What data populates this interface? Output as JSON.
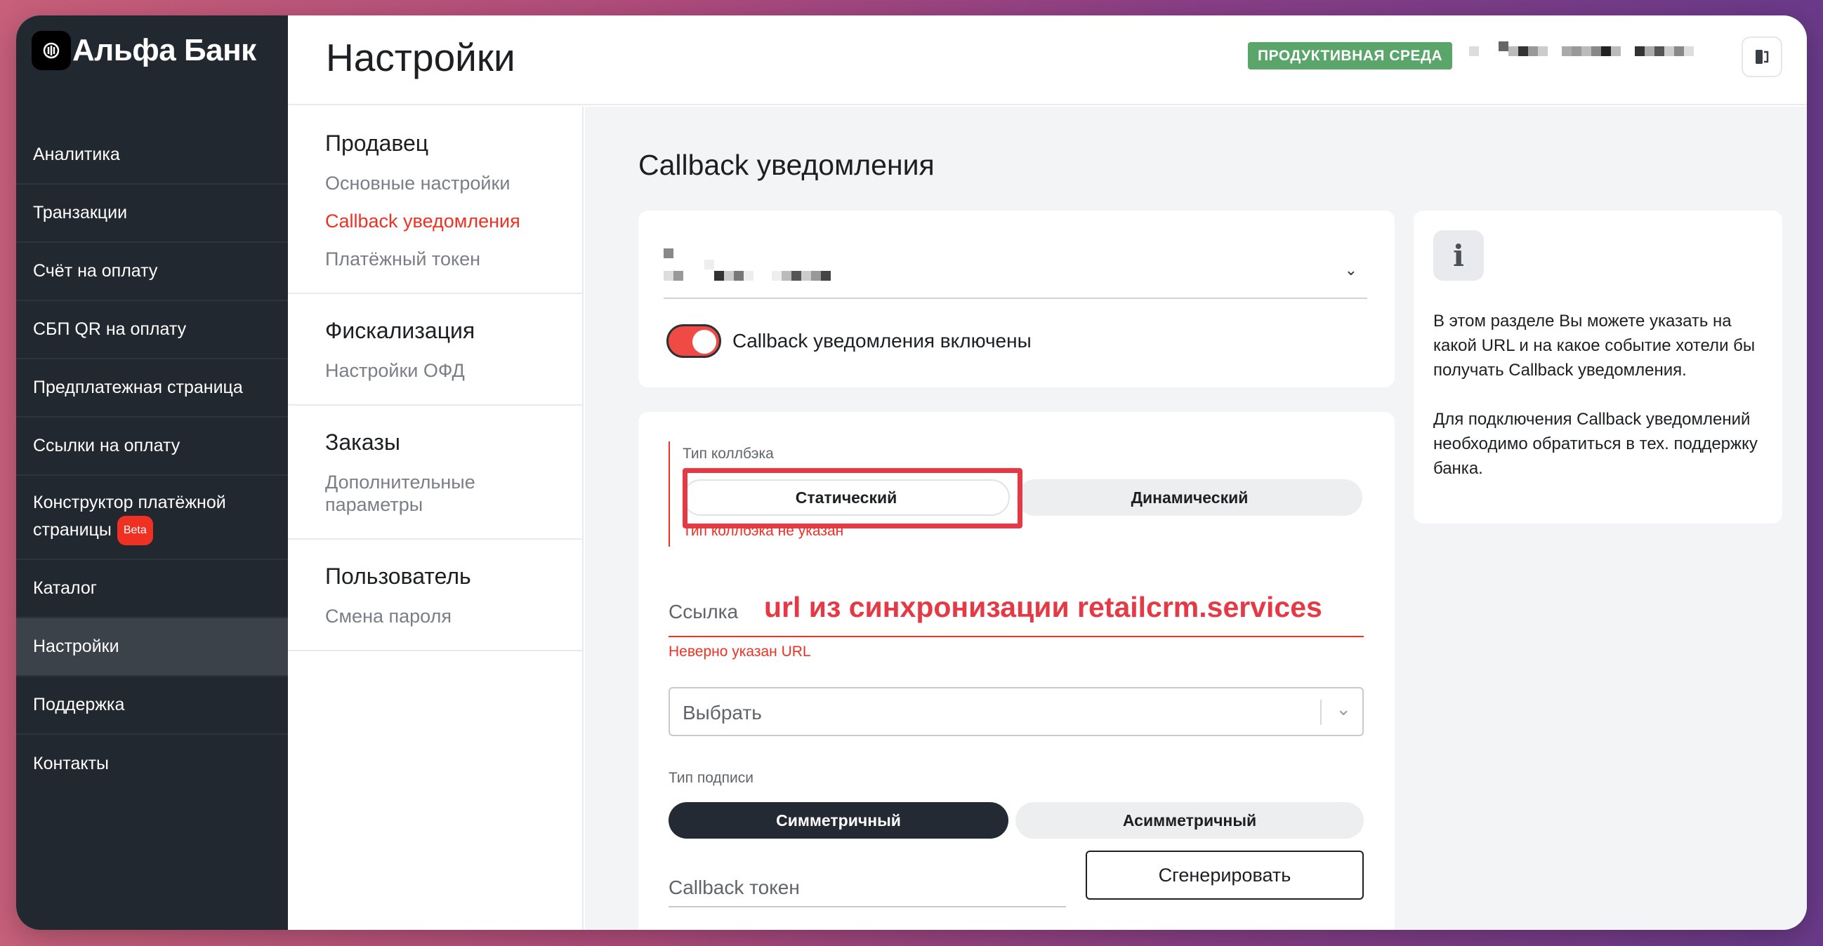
{
  "brand": {
    "name": "Альфа Банк"
  },
  "sidebar": {
    "items": [
      {
        "label": "Аналитика"
      },
      {
        "label": "Транзакции"
      },
      {
        "label": "Счёт на оплату"
      },
      {
        "label": "СБП QR на оплату"
      },
      {
        "label": "Предплатежная страница"
      },
      {
        "label": "Ссылки на оплату"
      },
      {
        "label": "Конструктор платёжной страницы",
        "badge": "Beta"
      },
      {
        "label": "Каталог"
      },
      {
        "label": "Настройки",
        "active": true
      },
      {
        "label": "Поддержка"
      },
      {
        "label": "Контакты"
      }
    ]
  },
  "header": {
    "title": "Настройки",
    "env_badge": "ПРОДУКТИВНАЯ СРЕДА",
    "env_badge_color": "#5aa56a"
  },
  "subnav": {
    "groups": [
      {
        "title": "Продавец",
        "links": [
          "Основные настройки",
          "Callback уведомления",
          "Платёжный токен"
        ]
      },
      {
        "title": "Фискализация",
        "links": [
          "Настройки ОФД"
        ]
      },
      {
        "title": "Заказы",
        "links": [
          "Дополнительные параметры"
        ]
      },
      {
        "title": "Пользователь",
        "links": [
          "Смена пароля"
        ]
      }
    ]
  },
  "main": {
    "section_title": "Callback уведомления",
    "toggle": {
      "label": "Callback уведомления включены",
      "on": true
    },
    "callback_type": {
      "label": "Тип коллбэка",
      "options": [
        "Статический",
        "Динамический"
      ],
      "error": "Тип коллбэка не указан"
    },
    "url": {
      "label": "Ссылка",
      "annotation": "url из синхронизации retailcrm.services",
      "error": "Неверно указан URL"
    },
    "select": {
      "placeholder": "Выбрать"
    },
    "signature_type": {
      "label": "Тип подписи",
      "options": [
        "Симметричный",
        "Асимметричный"
      ],
      "selected": "Симметричный"
    },
    "token": {
      "label": "Callback токен",
      "generate_button": "Сгенерировать"
    }
  },
  "info": {
    "icon": "info-icon",
    "paragraphs": [
      "В этом разделе Вы можете указать на какой URL и на какое событие хотели бы получать Callback уведомления.",
      "Для подключения Callback уведомлений необходимо обратиться в тех. поддержку банка."
    ]
  },
  "colors": {
    "accent": "#ef3124",
    "sidebar": "#22282f",
    "annotation": "#e53a45"
  }
}
